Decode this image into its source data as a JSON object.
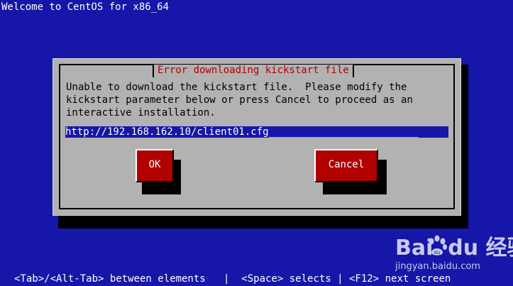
{
  "screen": {
    "title": "Welcome to CentOS for x86_64",
    "background_color": "#1616a8"
  },
  "dialog": {
    "title": "Error downloading kickstart file",
    "message": "Unable to download the kickstart file.  Please modify the\nkickstart parameter below or press Cancel to proceed as an\ninteractive installation.",
    "url_input": {
      "value": "http://192.168.162.10/client01.cfg_________________________"
    },
    "buttons": {
      "ok_label": "OK",
      "cancel_label": "Cancel"
    },
    "colors": {
      "background": "#b2b2b2",
      "title_text": "#b00000",
      "button_background": "#b00000",
      "input_background": "#1616a8"
    }
  },
  "status_bar": {
    "text": "<Tab>/<Alt-Tab> between elements   |  <Space> selects | <F12> next screen"
  },
  "watermark": {
    "logo_text": "Bai  du 经验",
    "url": "jingyan.baidu.com",
    "icon": "baidu-paw-icon"
  }
}
